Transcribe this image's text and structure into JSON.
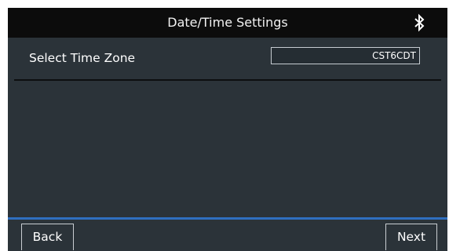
{
  "header": {
    "title": "Date/Time Settings",
    "bluetooth_icon": "bluetooth-icon"
  },
  "timezone": {
    "label": "Select Time Zone",
    "value": "CST6CDT"
  },
  "footer": {
    "back_label": "Back",
    "next_label": "Next"
  },
  "colors": {
    "title_bar": "#0c0c0c",
    "panel": "#2b3339",
    "accent": "#2f6fc0",
    "text": "#ffffff"
  }
}
